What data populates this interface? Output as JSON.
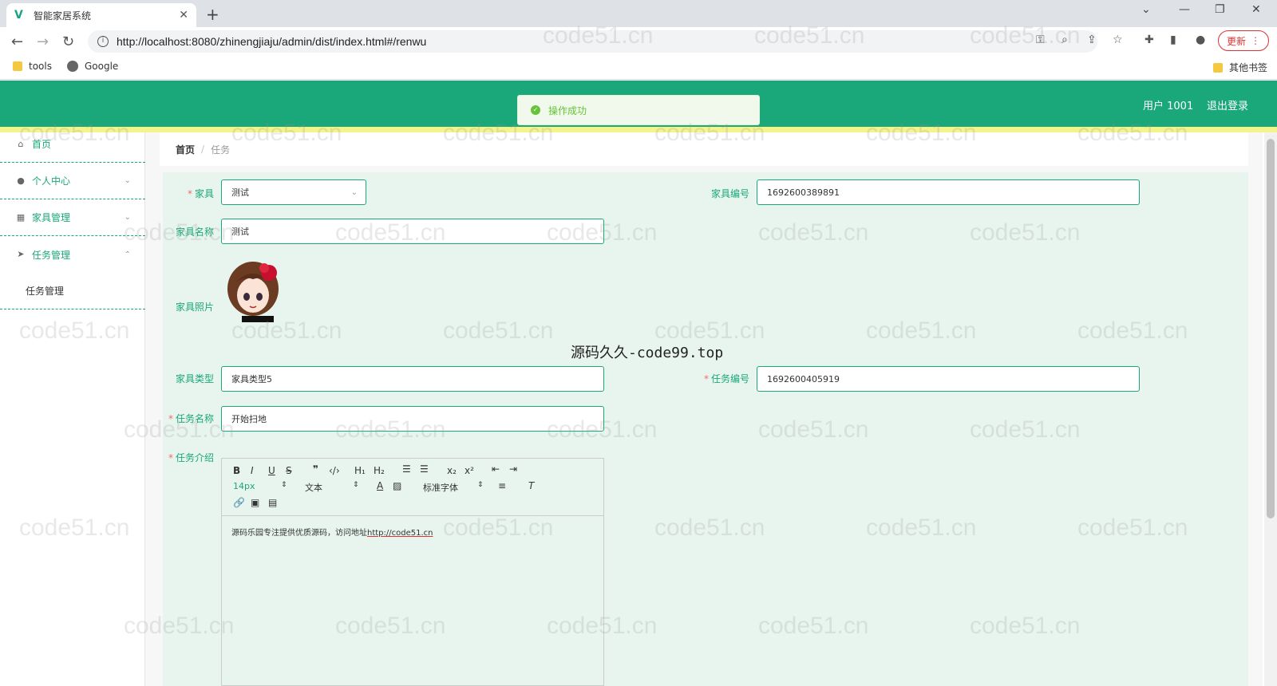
{
  "browser": {
    "tab_title": "智能家居系统",
    "tab_close": "✕",
    "new_tab": "+",
    "url": "http://localhost:8080/zhinengjiaju/admin/dist/index.html#/renwu",
    "update_label": "更新",
    "bookmarks": [
      "tools",
      "Google"
    ],
    "other_bookmarks": "其他书签",
    "window_controls": [
      "⌄",
      "—",
      "❐",
      "✕"
    ]
  },
  "header": {
    "user": "用户 1001",
    "logout": "退出登录"
  },
  "toast": {
    "message": "操作成功",
    "color": "#67c23a"
  },
  "sidebar": {
    "items": [
      {
        "label": "首页",
        "icon": "home-icon"
      },
      {
        "label": "个人中心",
        "icon": "user-icon"
      },
      {
        "label": "家具管理",
        "icon": "grid-icon"
      },
      {
        "label": "任务管理",
        "icon": "send-icon"
      }
    ],
    "sub_item": "任务管理"
  },
  "breadcrumb": {
    "home": "首页",
    "sep": "/",
    "current": "任务"
  },
  "form": {
    "furniture_label": "家具",
    "furniture_value": "测试",
    "furniture_no_label": "家具编号",
    "furniture_no_value": "1692600389891",
    "furniture_name_label": "家具名称",
    "furniture_name_value": "测试",
    "furniture_photo_label": "家具照片",
    "furniture_type_label": "家具类型",
    "furniture_type_value": "家具类型5",
    "task_no_label": "任务编号",
    "task_no_value": "1692600405919",
    "task_name_label": "任务名称",
    "task_name_value": "开始扫地",
    "task_intro_label": "任务介绍",
    "required_mark": "*"
  },
  "editor": {
    "font_size": "14px",
    "text_style": "文本",
    "font_family": "标准字体",
    "content_prefix": "源码乐园专注提供优质源码，访问地址",
    "content_link": "http://code51.cn"
  },
  "watermark_center": "源码久久-code99.top",
  "watermark": "code51.cn",
  "colors": {
    "primary": "#1aa77a",
    "form_bg": "#e8f5ef",
    "accent_line": "#f4f48a"
  }
}
